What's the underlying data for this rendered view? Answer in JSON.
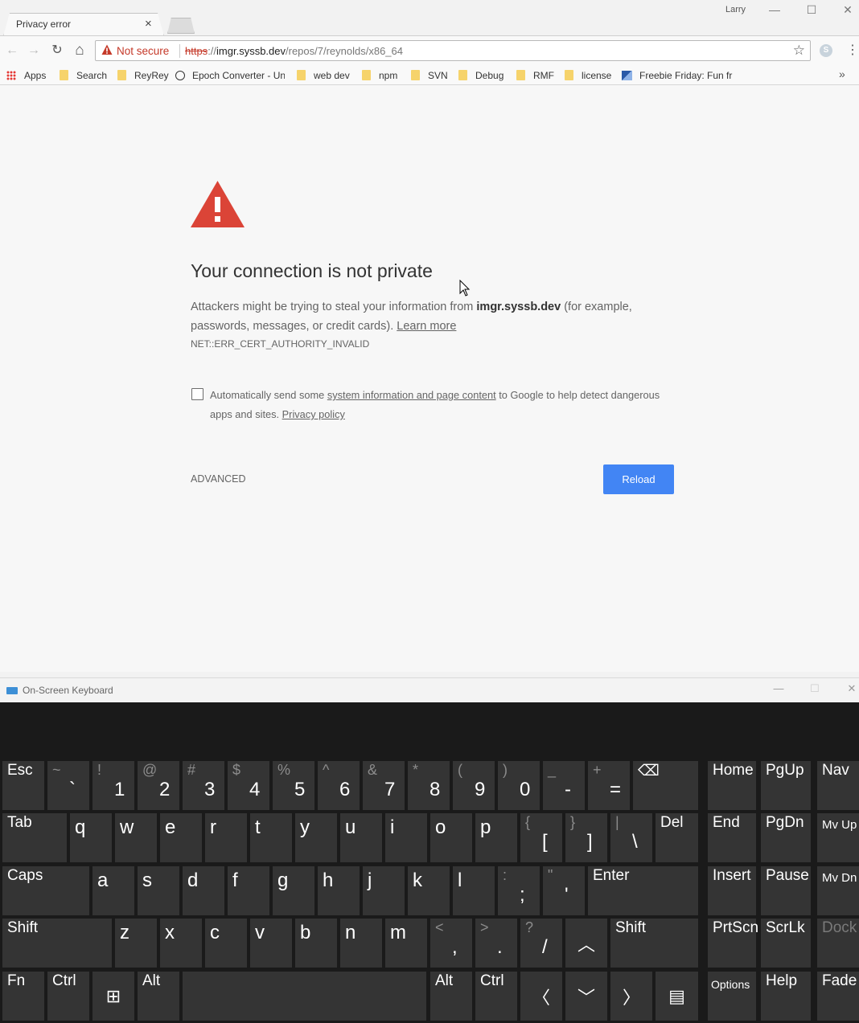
{
  "browser": {
    "tab_title": "Privacy error",
    "tab_close": "×",
    "profile_name": "Larry",
    "window_controls": [
      "—",
      "☐",
      "✕"
    ],
    "nav": {
      "back": "←",
      "forward": "→",
      "reload": "↻",
      "home": "⌂"
    },
    "omnibox": {
      "security_label": "Not secure",
      "url_scheme": "https",
      "url_sep": "://",
      "url_host": "imgr.syssb.dev",
      "url_path": "/repos/7/reynolds/x86_64",
      "star": "☆"
    },
    "extension_icon": "S",
    "menu": "⋮",
    "bookmarks": [
      {
        "label": "Apps",
        "icon": "apps-grid-icon"
      },
      {
        "label": "Search",
        "icon": "folder-icon"
      },
      {
        "label": "ReyRey",
        "icon": "folder-icon"
      },
      {
        "label": "Epoch Converter - Un",
        "icon": "clock-icon"
      },
      {
        "label": "web dev",
        "icon": "folder-icon"
      },
      {
        "label": "npm",
        "icon": "folder-icon"
      },
      {
        "label": "SVN",
        "icon": "folder-icon"
      },
      {
        "label": "Debug",
        "icon": "folder-icon"
      },
      {
        "label": "RMF",
        "icon": "folder-icon"
      },
      {
        "label": "license",
        "icon": "folder-icon"
      },
      {
        "label": "Freebie Friday: Fun fr",
        "icon": "page-icon"
      }
    ],
    "bookmarks_more": "»"
  },
  "error_page": {
    "title": "Your connection is not private",
    "body_before": "Attackers might be trying to steal your information from ",
    "body_host": "imgr.syssb.dev",
    "body_after": " (for example, passwords, messages, or credit cards). ",
    "learn_more": "Learn more",
    "error_code": "NET::ERR_CERT_AUTHORITY_INVALID",
    "optin_before": "Automatically send some ",
    "optin_link": "system information and page content",
    "optin_after": " to Google to help detect dangerous apps and sites. ",
    "privacy_link": "Privacy policy",
    "advanced": "ADVANCED",
    "reload": "Reload"
  },
  "osk": {
    "title": "On-Screen Keyboard",
    "controls": [
      "—",
      "☐",
      "✕"
    ],
    "row1": [
      {
        "lbl": "Esc"
      },
      {
        "sh": "~",
        "main": "`"
      },
      {
        "sh": "!",
        "main": "1"
      },
      {
        "sh": "@",
        "main": "2"
      },
      {
        "sh": "#",
        "main": "3"
      },
      {
        "sh": "$",
        "main": "4"
      },
      {
        "sh": "%",
        "main": "5"
      },
      {
        "sh": "^",
        "main": "6"
      },
      {
        "sh": "&",
        "main": "7"
      },
      {
        "sh": "*",
        "main": "8"
      },
      {
        "sh": "(",
        "main": "9"
      },
      {
        "sh": ")",
        "main": "0"
      },
      {
        "sh": "_",
        "main": "-"
      },
      {
        "sh": "+",
        "main": "="
      },
      {
        "lbl": "⌫"
      }
    ],
    "row2": [
      {
        "lbl": "Tab"
      },
      {
        "ltr": "q"
      },
      {
        "ltr": "w"
      },
      {
        "ltr": "e"
      },
      {
        "ltr": "r"
      },
      {
        "ltr": "t"
      },
      {
        "ltr": "y"
      },
      {
        "ltr": "u"
      },
      {
        "ltr": "i"
      },
      {
        "ltr": "o"
      },
      {
        "ltr": "p"
      },
      {
        "sh": "{",
        "main": "["
      },
      {
        "sh": "}",
        "main": "]"
      },
      {
        "sh": "|",
        "main": "\\"
      },
      {
        "lbl": "Del"
      }
    ],
    "row3": [
      {
        "lbl": "Caps"
      },
      {
        "ltr": "a"
      },
      {
        "ltr": "s"
      },
      {
        "ltr": "d"
      },
      {
        "ltr": "f"
      },
      {
        "ltr": "g"
      },
      {
        "ltr": "h"
      },
      {
        "ltr": "j"
      },
      {
        "ltr": "k"
      },
      {
        "ltr": "l"
      },
      {
        "sh": ":",
        "main": ";"
      },
      {
        "sh": "\"",
        "main": "'"
      },
      {
        "lbl": "Enter"
      }
    ],
    "row4": [
      {
        "lbl": "Shift"
      },
      {
        "ltr": "z"
      },
      {
        "ltr": "x"
      },
      {
        "ltr": "c"
      },
      {
        "ltr": "v"
      },
      {
        "ltr": "b"
      },
      {
        "ltr": "n"
      },
      {
        "ltr": "m"
      },
      {
        "sh": "<",
        "main": ","
      },
      {
        "sh": ">",
        "main": "."
      },
      {
        "sh": "?",
        "main": "/"
      },
      {
        "center": "︿"
      },
      {
        "lbl": "Shift"
      }
    ],
    "row5": [
      {
        "lbl": "Fn"
      },
      {
        "lbl": "Ctrl"
      },
      {
        "center": "⊞"
      },
      {
        "lbl": "Alt"
      },
      {
        "lbl": ""
      },
      {
        "lbl": "Alt"
      },
      {
        "lbl": "Ctrl"
      },
      {
        "center": "〈"
      },
      {
        "center": "﹀"
      },
      {
        "center": "〉"
      },
      {
        "center": "▤"
      }
    ],
    "nav_keys": [
      [
        "Home",
        "PgUp",
        "Nav"
      ],
      [
        "End",
        "PgDn",
        "Mv Up"
      ],
      [
        "Insert",
        "Pause",
        "Mv Dn"
      ],
      [
        "PrtScn",
        "ScrLk",
        "Dock"
      ],
      [
        "Options",
        "Help",
        "Fade"
      ]
    ]
  }
}
